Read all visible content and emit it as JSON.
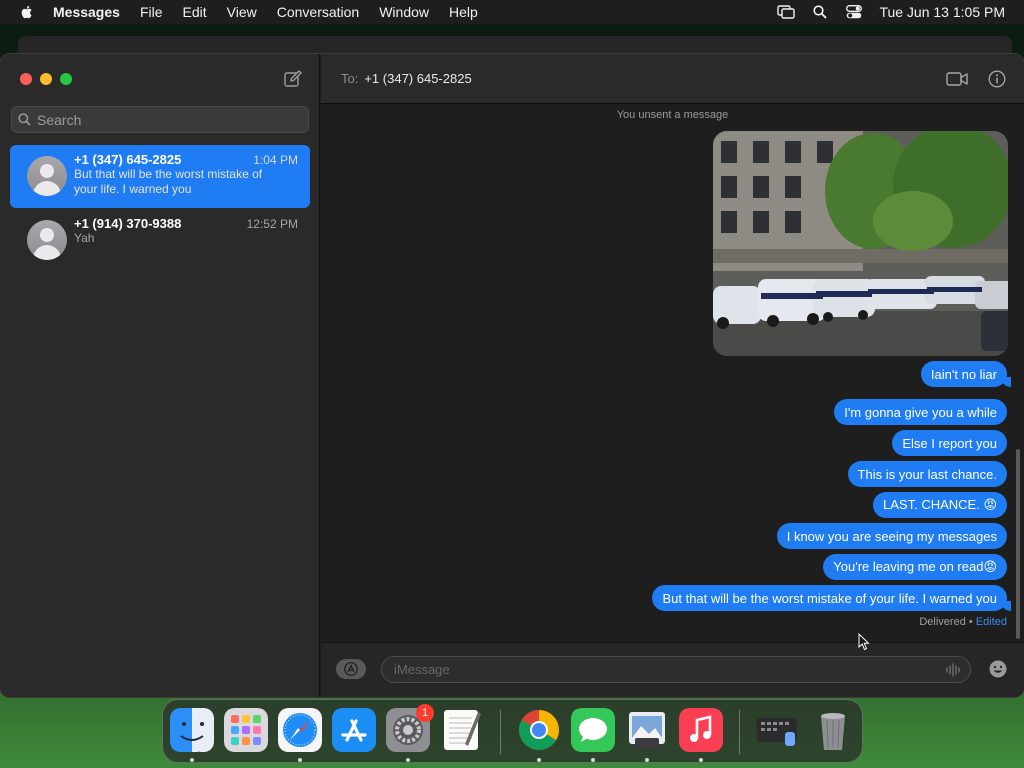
{
  "menubar": {
    "app_name": "Messages",
    "menus": [
      "File",
      "Edit",
      "View",
      "Conversation",
      "Window",
      "Help"
    ],
    "clock": "Tue Jun 13  1:05 PM",
    "status_icons": [
      "screen-mirroring-icon",
      "spotlight-search-icon",
      "control-center-icon"
    ]
  },
  "sidebar": {
    "search_placeholder": "Search",
    "conversations": [
      {
        "name": "+1 (347) 645-2825",
        "time": "1:04 PM",
        "preview": "But that will be the worst mistake of your life. I warned you",
        "selected": true
      },
      {
        "name": "+1 (914) 370-9388",
        "time": "12:52 PM",
        "preview": "Yah",
        "selected": false
      }
    ]
  },
  "chat": {
    "to_label": "To:",
    "to_value": "+1 (347) 645-2825",
    "unsent_notice": "You unsent a message",
    "messages": [
      "Iain't no liar",
      "I'm gonna give you a while",
      "Else I report you",
      "This is your last chance.",
      "LAST. CHANCE. 😡",
      "I know you are seeing my messages",
      "You're leaving me on read😡",
      "But that will be the worst mistake of your life. I warned you"
    ],
    "delivered": "Delivered",
    "separator": " • ",
    "edited": "Edited",
    "input_placeholder": "iMessage"
  },
  "dock": {
    "apps": [
      "Finder",
      "Launchpad",
      "Safari",
      "App Store",
      "System Settings",
      "TextEdit",
      "Google Chrome",
      "Messages",
      "Preview",
      "Music",
      "Downloads",
      "Trash"
    ],
    "settings_badge": "1"
  },
  "colors": {
    "accent": "#1f7cf2",
    "window_bg": "#1e1e1e",
    "sidebar_bg": "#2a2a2b"
  }
}
